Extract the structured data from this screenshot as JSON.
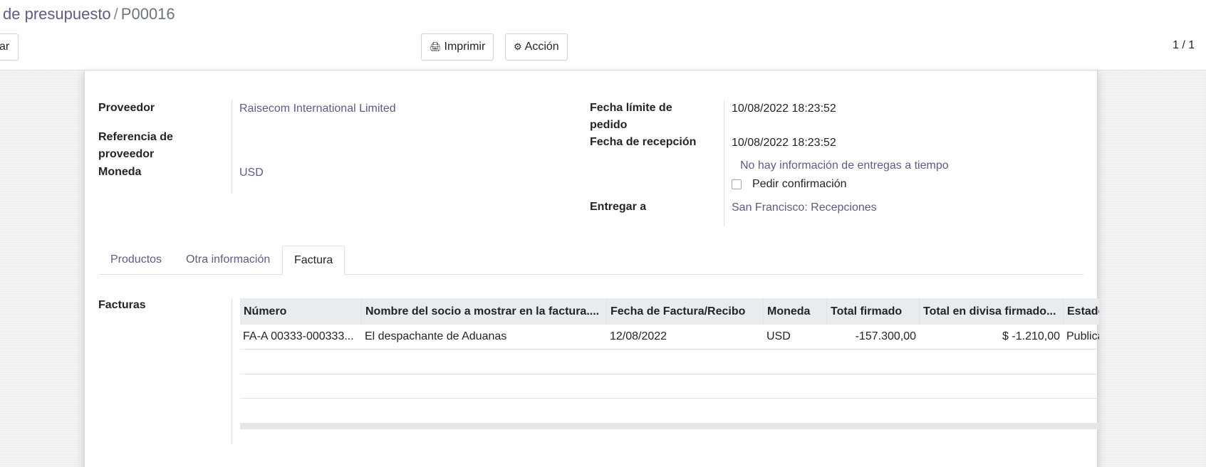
{
  "breadcrumb": {
    "parent": "de presupuesto",
    "separator": "/",
    "current": "P00016"
  },
  "toolbar": {
    "left_button": "ar",
    "print_label": "Imprimir",
    "action_label": "Acción",
    "pager": "1 / 1"
  },
  "form": {
    "proveedor_label": "Proveedor",
    "proveedor_value": "Raisecom International Limited",
    "referencia_label_1": "Referencia de",
    "referencia_label_2": "proveedor",
    "moneda_label": "Moneda",
    "moneda_value": "USD",
    "fecha_limite_label_1": "Fecha límite de",
    "fecha_limite_label_2": "pedido",
    "fecha_limite_value": "10/08/2022 18:23:52",
    "fecha_recepcion_label": "Fecha de recepción",
    "fecha_recepcion_value": "10/08/2022 18:23:52",
    "entregas_info": "No hay información de entregas a tiempo",
    "pedir_confirmacion_label": "Pedir confirmación",
    "entregar_a_label": "Entregar a",
    "entregar_a_value": "San Francisco: Recepciones"
  },
  "tabs": [
    {
      "label": "Productos",
      "active": false
    },
    {
      "label": "Otra información",
      "active": false
    },
    {
      "label": "Factura",
      "active": true
    }
  ],
  "facturas": {
    "label": "Facturas",
    "columns": [
      "Número",
      "Nombre del socio a mostrar en la factura....",
      "Fecha de Factura/Recibo",
      "Moneda",
      "Total firmado",
      "Total en divisa firmado...",
      "Estado"
    ],
    "rows": [
      {
        "numero": "FA-A 00333-000333...",
        "socio": "El despachante de Aduanas",
        "fecha": "12/08/2022",
        "moneda": "USD",
        "total_firmado": "-157.300,00",
        "total_divisa": "$ -1.210,00",
        "estado": "Publicado"
      }
    ]
  },
  "colors": {
    "link": "#5f5b86",
    "header_bg": "#e9ecef",
    "border": "#dee2e6"
  }
}
